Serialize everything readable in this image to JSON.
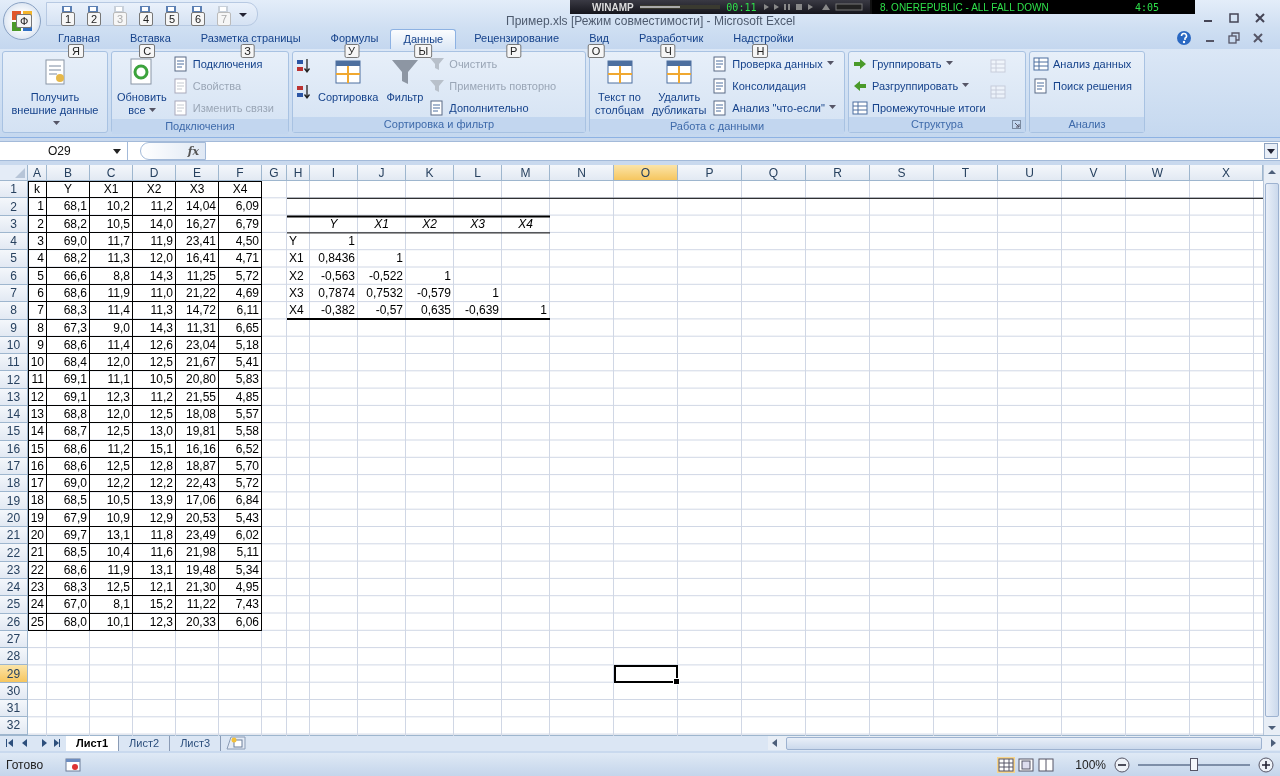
{
  "window": {
    "title": "Пример.xls  [Режим совместимости] - Microsoft Excel",
    "office_key": "Ф"
  },
  "quick_access": [
    {
      "key": "1",
      "disabled": false
    },
    {
      "key": "2",
      "disabled": false
    },
    {
      "key": "3",
      "disabled": true
    },
    {
      "key": "4",
      "disabled": false
    },
    {
      "key": "5",
      "disabled": false
    },
    {
      "key": "6",
      "disabled": false
    },
    {
      "key": "7",
      "disabled": true
    }
  ],
  "winamp": {
    "name": "WINAMP",
    "time": "00:11",
    "track": "8. ONEREPUBLIC - ALL FALL DOWN",
    "duration": "4:05"
  },
  "tabs": [
    {
      "label": "Главная",
      "key": "Я",
      "selected": false
    },
    {
      "label": "Вставка",
      "key": "С",
      "selected": false
    },
    {
      "label": "Разметка страницы",
      "key": "З",
      "selected": false
    },
    {
      "label": "Формулы",
      "key": "У",
      "selected": false
    },
    {
      "label": "Данные",
      "key": "Ы",
      "selected": true
    },
    {
      "label": "Рецензирование",
      "key": "Р",
      "selected": false
    },
    {
      "label": "Вид",
      "key": "О",
      "selected": false
    },
    {
      "label": "Разработчик",
      "key": "Ч",
      "selected": false
    },
    {
      "label": "Надстройки",
      "key": "Н",
      "selected": false
    }
  ],
  "ribbon": [
    {
      "items": [
        {
          "kind": "large",
          "label": "Получить\nвнешние данные",
          "dropdown": true,
          "disabled": false
        }
      ]
    },
    {
      "label": "Подключения",
      "items": [
        {
          "kind": "large",
          "label": "Обновить\nвсе",
          "dropdown": true,
          "disabled": false
        },
        {
          "kind": "small",
          "label": "Подключения",
          "dropdown": false,
          "disabled": false
        },
        {
          "kind": "small",
          "label": "Свойства",
          "dropdown": false,
          "disabled": true
        },
        {
          "kind": "small",
          "label": "Изменить связи",
          "dropdown": false,
          "disabled": true
        }
      ]
    },
    {
      "label": "Сортировка и фильтр",
      "items": [
        {
          "kind": "icon",
          "dropdown": false,
          "disabled": false
        },
        {
          "kind": "icon",
          "dropdown": false,
          "disabled": false
        },
        {
          "kind": "large",
          "label": "Сортировка",
          "dropdown": false,
          "disabled": false
        },
        {
          "kind": "large",
          "label": "Фильтр",
          "dropdown": false,
          "disabled": false
        },
        {
          "kind": "small",
          "label": "Очистить",
          "dropdown": false,
          "disabled": true
        },
        {
          "kind": "small",
          "label": "Применить повторно",
          "dropdown": false,
          "disabled": true
        },
        {
          "kind": "small",
          "label": "Дополнительно",
          "dropdown": false,
          "disabled": false
        }
      ]
    },
    {
      "label": "Работа с данными",
      "items": [
        {
          "kind": "large",
          "label": "Текст по\nстолбцам",
          "dropdown": false,
          "disabled": false
        },
        {
          "kind": "large",
          "label": "Удалить\nдубликаты",
          "dropdown": false,
          "disabled": false
        },
        {
          "kind": "small",
          "label": "Проверка данных",
          "dropdown": true,
          "disabled": false
        },
        {
          "kind": "small",
          "label": "Консолидация",
          "dropdown": false,
          "disabled": false
        },
        {
          "kind": "small",
          "label": "Анализ \"что-если\"",
          "dropdown": true,
          "disabled": false
        }
      ]
    },
    {
      "label": "Структура",
      "launcher": true,
      "items": [
        {
          "kind": "small",
          "label": "Группировать",
          "dropdown": true,
          "disabled": false
        },
        {
          "kind": "small",
          "label": "Разгруппировать",
          "dropdown": true,
          "disabled": false
        },
        {
          "kind": "small",
          "label": "Промежуточные итоги",
          "dropdown": false,
          "disabled": false
        },
        {
          "kind": "icon",
          "dropdown": false,
          "disabled": true
        },
        {
          "kind": "icon",
          "dropdown": false,
          "disabled": true
        }
      ]
    },
    {
      "label": "Анализ",
      "items": [
        {
          "kind": "small",
          "label": "Анализ данных",
          "dropdown": false,
          "disabled": false
        },
        {
          "kind": "small",
          "label": "Поиск решения",
          "dropdown": false,
          "disabled": false
        }
      ]
    }
  ],
  "formula_bar": {
    "name_box": "O29",
    "fx": "fx"
  },
  "columns": [
    {
      "label": "A",
      "selected": false
    },
    {
      "label": "B",
      "selected": false
    },
    {
      "label": "C",
      "selected": false
    },
    {
      "label": "D",
      "selected": false
    },
    {
      "label": "E",
      "selected": false
    },
    {
      "label": "F",
      "selected": false
    },
    {
      "label": "G",
      "selected": false
    },
    {
      "label": "H",
      "selected": false
    },
    {
      "label": "I",
      "selected": false
    },
    {
      "label": "J",
      "selected": false
    },
    {
      "label": "K",
      "selected": false
    },
    {
      "label": "L",
      "selected": false
    },
    {
      "label": "M",
      "selected": false
    },
    {
      "label": "N",
      "selected": false
    },
    {
      "label": "O",
      "selected": true
    },
    {
      "label": "P",
      "selected": false
    },
    {
      "label": "Q",
      "selected": false
    },
    {
      "label": "R",
      "selected": false
    },
    {
      "label": "S",
      "selected": false
    },
    {
      "label": "T",
      "selected": false
    },
    {
      "label": "U",
      "selected": false
    },
    {
      "label": "V",
      "selected": false
    },
    {
      "label": "W",
      "selected": false
    },
    {
      "label": "X",
      "selected": false
    }
  ],
  "rows": [
    {
      "label": "1",
      "selected": false
    },
    {
      "label": "2",
      "selected": false
    },
    {
      "label": "3",
      "selected": false
    },
    {
      "label": "4",
      "selected": false
    },
    {
      "label": "5",
      "selected": false
    },
    {
      "label": "6",
      "selected": false
    },
    {
      "label": "7",
      "selected": false
    },
    {
      "label": "8",
      "selected": false
    },
    {
      "label": "9",
      "selected": false
    },
    {
      "label": "10",
      "selected": false
    },
    {
      "label": "11",
      "selected": false
    },
    {
      "label": "12",
      "selected": false
    },
    {
      "label": "13",
      "selected": false
    },
    {
      "label": "14",
      "selected": false
    },
    {
      "label": "15",
      "selected": false
    },
    {
      "label": "16",
      "selected": false
    },
    {
      "label": "17",
      "selected": false
    },
    {
      "label": "18",
      "selected": false
    },
    {
      "label": "19",
      "selected": false
    },
    {
      "label": "20",
      "selected": false
    },
    {
      "label": "21",
      "selected": false
    },
    {
      "label": "22",
      "selected": false
    },
    {
      "label": "23",
      "selected": false
    },
    {
      "label": "24",
      "selected": false
    },
    {
      "label": "25",
      "selected": false
    },
    {
      "label": "26",
      "selected": false
    },
    {
      "label": "27",
      "selected": false
    },
    {
      "label": "28",
      "selected": false
    },
    {
      "label": "29",
      "selected": true
    },
    {
      "label": "30",
      "selected": false
    },
    {
      "label": "31",
      "selected": false
    },
    {
      "label": "32",
      "selected": false
    }
  ],
  "data_table": {
    "header": [
      "k",
      "Y",
      "X1",
      "X2",
      "X3",
      "X4"
    ],
    "rows": [
      [
        "1",
        "68,1",
        "10,2",
        "11,2",
        "14,04",
        "6,09"
      ],
      [
        "2",
        "68,2",
        "10,5",
        "14,0",
        "16,27",
        "6,79"
      ],
      [
        "3",
        "69,0",
        "11,7",
        "11,9",
        "23,41",
        "4,50"
      ],
      [
        "4",
        "68,2",
        "11,3",
        "12,0",
        "16,41",
        "4,71"
      ],
      [
        "5",
        "66,6",
        "8,8",
        "14,3",
        "11,25",
        "5,72"
      ],
      [
        "6",
        "68,6",
        "11,9",
        "11,0",
        "21,22",
        "4,69"
      ],
      [
        "7",
        "68,3",
        "11,4",
        "11,3",
        "14,72",
        "6,11"
      ],
      [
        "8",
        "67,3",
        "9,0",
        "14,3",
        "11,31",
        "6,65"
      ],
      [
        "9",
        "68,6",
        "11,4",
        "12,6",
        "23,04",
        "5,18"
      ],
      [
        "10",
        "68,4",
        "12,0",
        "12,5",
        "21,67",
        "5,41"
      ],
      [
        "11",
        "69,1",
        "11,1",
        "10,5",
        "20,80",
        "5,83"
      ],
      [
        "12",
        "69,1",
        "12,3",
        "11,2",
        "21,55",
        "4,85"
      ],
      [
        "13",
        "68,8",
        "12,0",
        "12,5",
        "18,08",
        "5,57"
      ],
      [
        "14",
        "68,7",
        "12,5",
        "13,0",
        "19,81",
        "5,58"
      ],
      [
        "15",
        "68,6",
        "11,2",
        "15,1",
        "16,16",
        "6,52"
      ],
      [
        "16",
        "68,6",
        "12,5",
        "12,8",
        "18,87",
        "5,70"
      ],
      [
        "17",
        "69,0",
        "12,2",
        "12,2",
        "22,43",
        "5,72"
      ],
      [
        "18",
        "68,5",
        "10,5",
        "13,9",
        "17,06",
        "6,84"
      ],
      [
        "19",
        "67,9",
        "10,9",
        "12,9",
        "20,53",
        "5,43"
      ],
      [
        "20",
        "69,7",
        "13,1",
        "11,8",
        "23,49",
        "6,02"
      ],
      [
        "21",
        "68,5",
        "10,4",
        "11,6",
        "21,98",
        "5,11"
      ],
      [
        "22",
        "68,6",
        "11,9",
        "13,1",
        "19,48",
        "5,34"
      ],
      [
        "23",
        "68,3",
        "12,5",
        "12,1",
        "21,30",
        "4,95"
      ],
      [
        "24",
        "67,0",
        "8,1",
        "15,2",
        "11,22",
        "7,43"
      ],
      [
        "25",
        "68,0",
        "10,1",
        "12,3",
        "20,33",
        "6,06"
      ]
    ]
  },
  "correlation": {
    "header": [
      "Y",
      "X1",
      "X2",
      "X3",
      "X4"
    ],
    "rows": [
      {
        "label": "Y",
        "values": [
          "1"
        ]
      },
      {
        "label": "X1",
        "values": [
          "0,8436",
          "1"
        ]
      },
      {
        "label": "X2",
        "values": [
          "-0,563",
          "-0,522",
          "1"
        ]
      },
      {
        "label": "X3",
        "values": [
          "0,7874",
          "0,7532",
          "-0,579",
          "1"
        ]
      },
      {
        "label": "X4",
        "values": [
          "-0,382",
          "-0,57",
          "0,635",
          "-0,639",
          "1"
        ]
      }
    ]
  },
  "sheet_tabs": [
    {
      "label": "Лист1",
      "selected": true
    },
    {
      "label": "Лист2",
      "selected": false
    },
    {
      "label": "Лист3",
      "selected": false
    }
  ],
  "status_bar": {
    "status": "Готово",
    "zoom": "100%",
    "zoom_level": {
      "level": 0.5
    }
  }
}
